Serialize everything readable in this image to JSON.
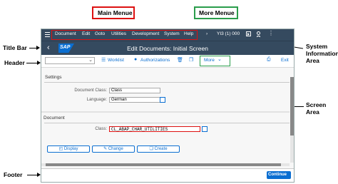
{
  "annotations": {
    "main_menu": "Main Menue",
    "more_menu": "More Menue",
    "title_bar": "Title Bar",
    "header": "Header",
    "system_info_line1": "System",
    "system_info_line2": "Information",
    "system_info_line3": "Area",
    "screen_area_line1": "Screen",
    "screen_area_line2": "Area",
    "footer": "Footer"
  },
  "menubar": {
    "items": [
      "Document",
      "Edit",
      "Goto",
      "Utilities",
      "Development",
      "System",
      "Help"
    ],
    "system_info": "YI3 (1) 000"
  },
  "titlebar": {
    "logo": "SAP",
    "title": "Edit Documents: Initial Screen"
  },
  "toolbar": {
    "worklist": "Worklist",
    "authorizations": "Authorizations",
    "more": "More",
    "exit": "Exit"
  },
  "settings": {
    "title": "Settings",
    "document_class_label": "Document Class:",
    "document_class_value": "Class",
    "language_label": "Language:",
    "language_value": "German"
  },
  "document": {
    "title": "Document",
    "class_label": "Class:",
    "class_value": "CL_ABAP_CHAR_UTILITIES",
    "display": "Display",
    "change": "Change",
    "create": "Create"
  },
  "footer": {
    "continue": "Continue"
  },
  "colors": {
    "shell": "#354a5f",
    "accent": "#0a6ed1",
    "annotation_red": "#dd1111",
    "annotation_green": "#2a9d4b"
  }
}
